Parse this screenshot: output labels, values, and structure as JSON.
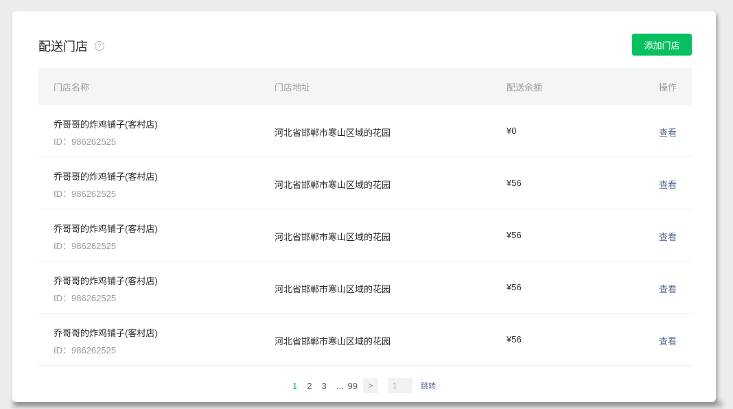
{
  "header": {
    "title": "配送门店",
    "help_symbol": "?",
    "add_button_label": "添加门店"
  },
  "table": {
    "columns": {
      "name": "门店名称",
      "address": "门店地址",
      "balance": "配送余额",
      "action": "操作"
    },
    "rows": [
      {
        "name": "乔哥哥的炸鸡铺子(客村店)",
        "id": "ID：986262525",
        "address": "河北省邯郸市寒山区域的花园",
        "balance": "¥0",
        "action": "查看"
      },
      {
        "name": "乔哥哥的炸鸡铺子(客村店)",
        "id": "ID：986262525",
        "address": "河北省邯郸市寒山区域的花园",
        "balance": "¥56",
        "action": "查看"
      },
      {
        "name": "乔哥哥的炸鸡铺子(客村店)",
        "id": "ID：986262525",
        "address": "河北省邯郸市寒山区域的花园",
        "balance": "¥56",
        "action": "查看"
      },
      {
        "name": "乔哥哥的炸鸡铺子(客村店)",
        "id": "ID：986262525",
        "address": "河北省邯郸市寒山区域的花园",
        "balance": "¥56",
        "action": "查看"
      },
      {
        "name": "乔哥哥的炸鸡铺子(客村店)",
        "id": "ID：986262525",
        "address": "河北省邯郸市寒山区域的花园",
        "balance": "¥56",
        "action": "查看"
      }
    ]
  },
  "pagination": {
    "pages": [
      "1",
      "2",
      "3"
    ],
    "ellipsis": "...",
    "last_page": "99",
    "current": "1",
    "next_symbol": ">",
    "jump_value": "1",
    "jump_label": "跳转"
  },
  "colors": {
    "primary_green": "#07c160",
    "link_blue": "#576b95"
  }
}
